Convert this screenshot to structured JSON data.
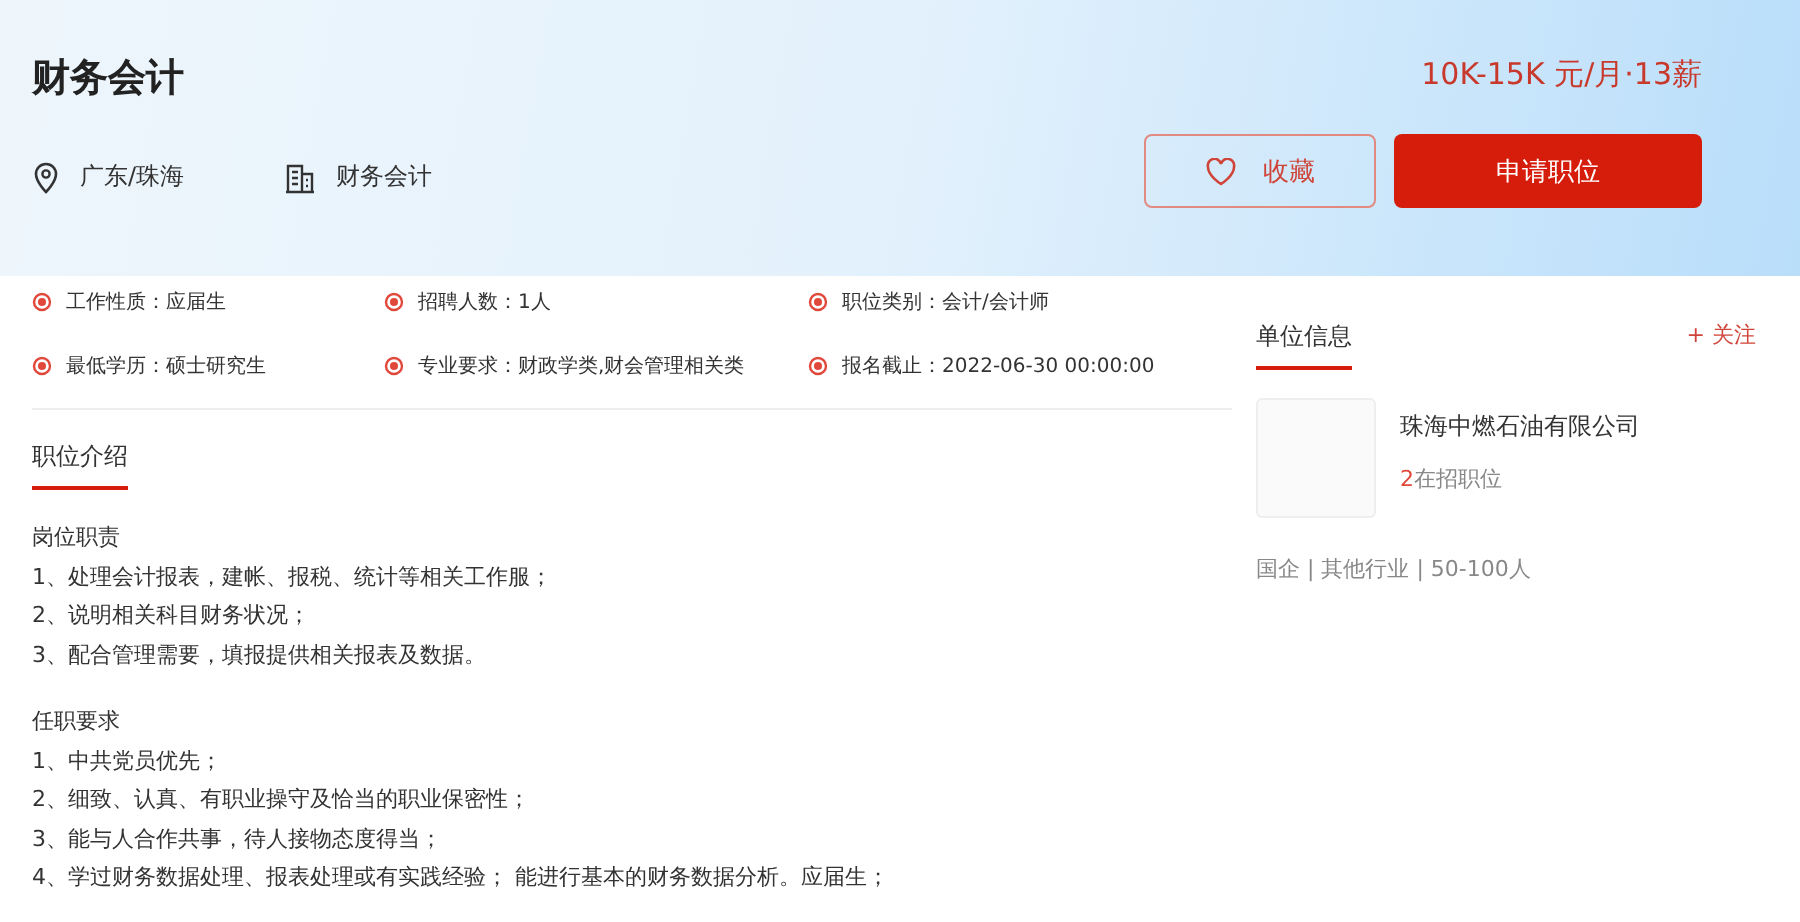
{
  "job": {
    "title": "财务会计",
    "location": "广东/珠海",
    "category": "财务会计",
    "salary": "10K-15K 元/月·13薪"
  },
  "buttons": {
    "favorite": "收藏",
    "apply": "申请职位"
  },
  "facts": [
    {
      "label": "工作性质：",
      "value": "应届生"
    },
    {
      "label": "招聘人数：",
      "value": "1人"
    },
    {
      "label": "职位类别：",
      "value": "会计/会计师"
    },
    {
      "label": "最低学历：",
      "value": "硕士研究生"
    },
    {
      "label": "专业要求：",
      "value": "财政学类,财会管理相关类"
    },
    {
      "label": "报名截止：",
      "value": "2022-06-30 00:00:00"
    }
  ],
  "company": {
    "heading": "单位信息",
    "follow": "+ 关注",
    "name": "珠海中燃石油有限公司",
    "open_count": "2",
    "open_label": "在招职位",
    "meta": "国企 | 其他行业 | 50-100人"
  },
  "intro": {
    "heading": "职位介绍",
    "sections": [
      {
        "title": "岗位职责",
        "lines": [
          "1、处理会计报表，建帐、报税、统计等相关工作服；",
          "2、说明相关科目财务状况；",
          "3、配合管理需要，填报提供相关报表及数据。"
        ]
      },
      {
        "title": "任职要求",
        "lines": [
          "1、中共党员优先；",
          "2、细致、认真、有职业操守及恰当的职业保密性；",
          "3、能与人合作共事，待人接物态度得当；",
          "4、学过财务数据处理、报表处理或有实践经验； 能进行基本的财务数据分析。应届生；"
        ]
      }
    ]
  }
}
